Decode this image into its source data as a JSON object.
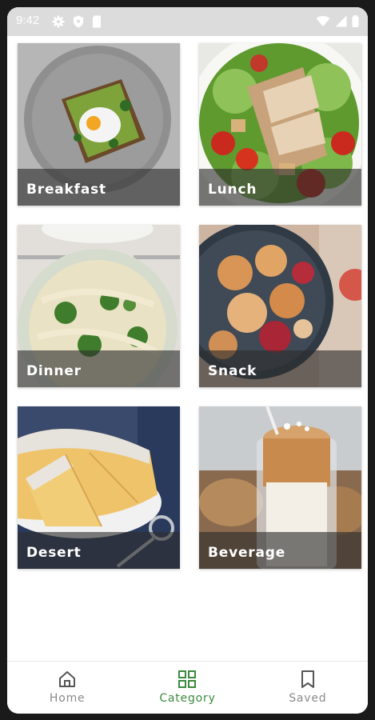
{
  "status_bar": {
    "time": "9:42",
    "left_icons": [
      "gear-icon",
      "shield-icon",
      "sd-card-icon"
    ],
    "right_icons": [
      "wifi-icon",
      "signal-icon",
      "battery-icon"
    ]
  },
  "categories": [
    {
      "label": "Breakfast",
      "image": "avocado toast with poached egg on grey plate"
    },
    {
      "label": "Lunch",
      "image": "chicken salad with tomatoes and croutons"
    },
    {
      "label": "Dinner",
      "image": "pasta with broccoli"
    },
    {
      "label": "Snack",
      "image": "chips in dark bowl"
    },
    {
      "label": "Desert",
      "image": "sliced sponge cake on cake stand"
    },
    {
      "label": "Beverage",
      "image": "whipped coffee in glass"
    }
  ],
  "bottom_nav": {
    "items": [
      {
        "label": "Home",
        "icon": "home-icon",
        "active": false
      },
      {
        "label": "Category",
        "icon": "grid-icon",
        "active": true
      },
      {
        "label": "Saved",
        "icon": "bookmark-icon",
        "active": false
      }
    ]
  },
  "colors": {
    "accent": "#3b8a3e",
    "inactive": "#8a8a8a",
    "caption_overlay": "#2d2d2d"
  }
}
